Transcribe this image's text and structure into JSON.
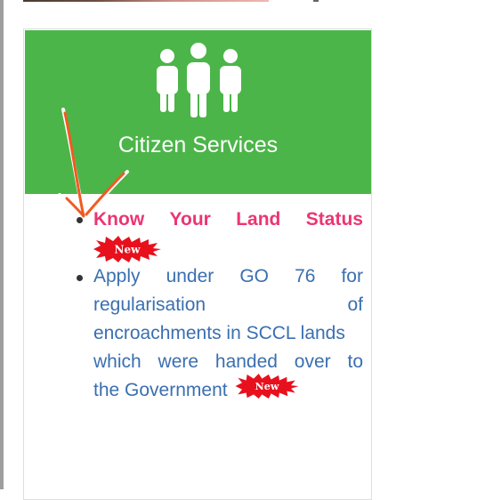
{
  "panel": {
    "title": "Citizen Services",
    "header_color": "#4cb549",
    "icon": "people-group-icon"
  },
  "services": [
    {
      "label": "Know Your Land Status",
      "words": [
        "Know",
        "Your",
        "Land",
        "Status"
      ],
      "badge": "New",
      "color": "#ec3572"
    },
    {
      "label": "Apply under GO 76 for regularisation of encroachments in SCCL lands which were handed over to the Government",
      "lines": [
        [
          "Apply",
          "under",
          "GO",
          "76",
          "for"
        ],
        [
          "regularisation",
          "of"
        ],
        [
          "encroachments in SCCL lands"
        ],
        [
          "which",
          "were",
          "handed",
          "over",
          "to"
        ],
        [
          "the Government"
        ]
      ],
      "badge": "New",
      "color": "#3a6fb0"
    }
  ]
}
